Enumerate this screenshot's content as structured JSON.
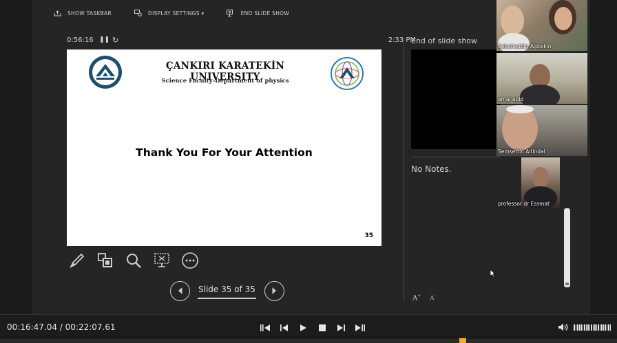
{
  "taskbar": {
    "show_taskbar": "SHOW TASKBAR",
    "display_settings": "DISPLAY SETTINGS ▾",
    "end_slide_show": "END SLIDE SHOW"
  },
  "presenter": {
    "elapsed": "0:56:16",
    "clock": "2:33 PM",
    "next_label": "End of slide show",
    "notes": "No Notes."
  },
  "slide": {
    "university": "ÇANKIRI KARATEKİN UNIVERSITY",
    "department": "Science Faculty-Department of physics",
    "message": "Thank You For Your  Attention",
    "number": "35"
  },
  "navigation": {
    "counter": "Slide 35 of 35"
  },
  "participants": [
    {
      "name": "Sebahaddin Alptekin"
    },
    {
      "name": "amal abid"
    },
    {
      "name": "Semsettin Altindal"
    },
    {
      "name": "professor dr Essmat"
    }
  ],
  "player": {
    "time": "00:16:47.04 / 00:22:07.61",
    "progress_fraction": 0.759
  },
  "icons": [
    "taskbar-icon",
    "display-settings-icon",
    "end-show-icon",
    "pause-icon",
    "restart-icon",
    "pen-icon",
    "all-slides-icon",
    "zoom-icon",
    "subtitles-icon",
    "more-icon",
    "prev-slide-icon",
    "next-slide-icon",
    "speaker-icon"
  ]
}
